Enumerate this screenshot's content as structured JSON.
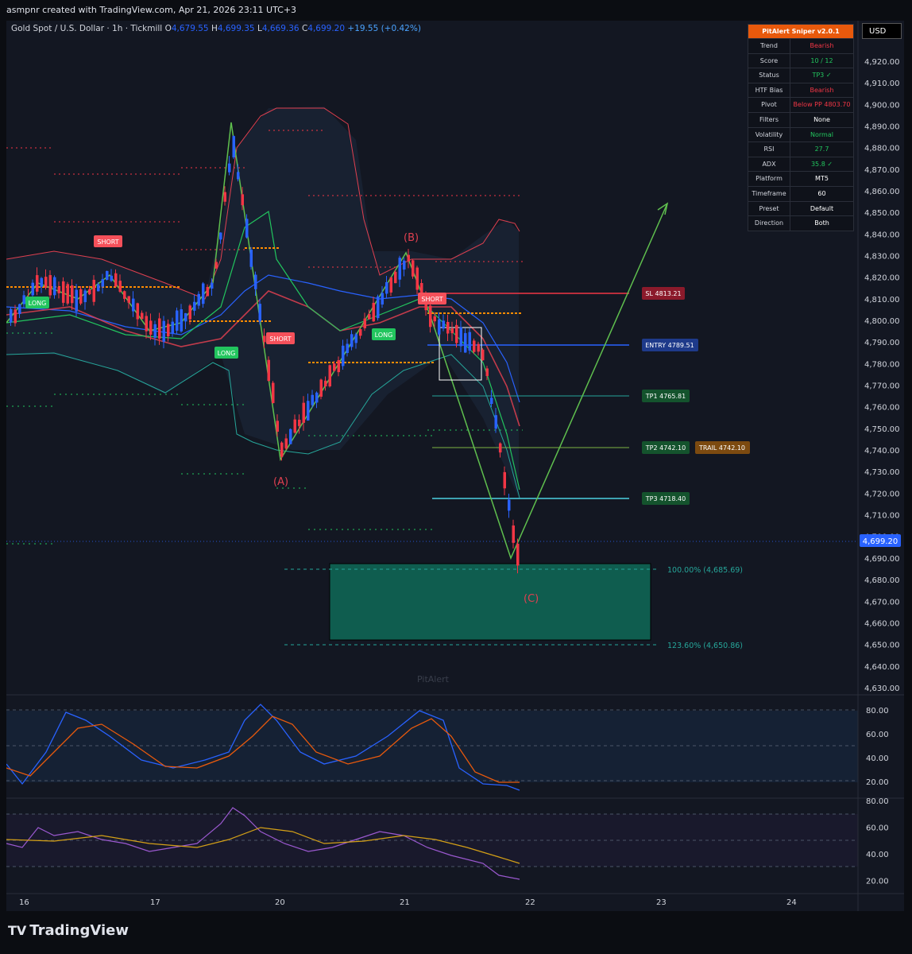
{
  "header": {
    "created_by": "asmpnr created with TradingView.com, Apr 21, 2026 23:11 UTC+3"
  },
  "legend": {
    "symbol": "Gold Spot / U.S. Dollar · 1h · Tickmill",
    "o_label": "O",
    "o": "4,679.55",
    "h_label": "H",
    "h": "4,699.35",
    "l_label": "L",
    "l": "4,669.36",
    "c_label": "C",
    "c": "4,699.20",
    "change": "+19.55 (+0.42%)"
  },
  "currency_button": "USD",
  "panel": {
    "title": "PitAlert Sniper v2.0.1",
    "rows": [
      {
        "k": "Trend",
        "v": "Bearish",
        "color": "#f23645"
      },
      {
        "k": "Score",
        "v": "10 / 12",
        "color": "#22c55e"
      },
      {
        "k": "Status",
        "v": "TP3 ✓",
        "color": "#22c55e"
      },
      {
        "k": "HTF Bias",
        "v": "Bearish",
        "color": "#f23645"
      },
      {
        "k": "Pivot",
        "v": "Below PP 4803.70",
        "color": "#f23645"
      },
      {
        "k": "Filters",
        "v": "None",
        "color": "#ffffff"
      },
      {
        "k": "Volatility",
        "v": "Normal",
        "color": "#22c55e"
      },
      {
        "k": "RSI",
        "v": "27.7",
        "color": "#22c55e"
      },
      {
        "k": "ADX",
        "v": "35.8 ✓",
        "color": "#22c55e"
      },
      {
        "k": "Platform",
        "v": "MT5",
        "color": "#ffffff"
      },
      {
        "k": "Timeframe",
        "v": "60",
        "color": "#ffffff"
      },
      {
        "k": "Preset",
        "v": "Default",
        "color": "#ffffff"
      },
      {
        "k": "Direction",
        "v": "Both",
        "color": "#ffffff"
      }
    ]
  },
  "price_axis": [
    "4,920.00",
    "4,910.00",
    "4,900.00",
    "4,890.00",
    "4,880.00",
    "4,870.00",
    "4,860.00",
    "4,850.00",
    "4,840.00",
    "4,830.00",
    "4,820.00",
    "4,810.00",
    "4,800.00",
    "4,790.00",
    "4,780.00",
    "4,770.00",
    "4,760.00",
    "4,750.00",
    "4,740.00",
    "4,730.00",
    "4,720.00",
    "4,710.00",
    "4,700.00",
    "4,690.00",
    "4,680.00",
    "4,670.00",
    "4,660.00",
    "4,650.00",
    "4,640.00",
    "4,630.00"
  ],
  "last_price": "4,699.20",
  "time_axis": [
    "16",
    "17",
    "20",
    "21",
    "22",
    "23",
    "24"
  ],
  "trade_labels": {
    "sl": "SL 4813.21",
    "entry": "ENTRY 4789.51",
    "tp1": "TP1 4765.81",
    "tp2": "TP2 4742.10",
    "trail": "TRAIL 4742.10",
    "tp3": "TP3 4718.40"
  },
  "signals": {
    "short": "SHORT",
    "long": "LONG"
  },
  "waves": {
    "a": "(A)",
    "b": "(B)",
    "c": "(C)"
  },
  "fib": {
    "f100": "100.00% (4,685.69)",
    "f123": "123.60% (4,650.86)"
  },
  "watermark": "PitAlert",
  "osc1_axis": [
    "80.00",
    "60.00",
    "40.00",
    "20.00"
  ],
  "osc2_axis": [
    "80.00",
    "60.00",
    "40.00",
    "20.00"
  ],
  "brand": {
    "logo": "TV",
    "name": "TradingView"
  },
  "colors": {
    "bull": "#2962ff",
    "bear": "#f23645",
    "signal_long": "#22c55e",
    "signal_short": "#f5505a",
    "target": "#26a69a",
    "accent": "#e8590c"
  }
}
